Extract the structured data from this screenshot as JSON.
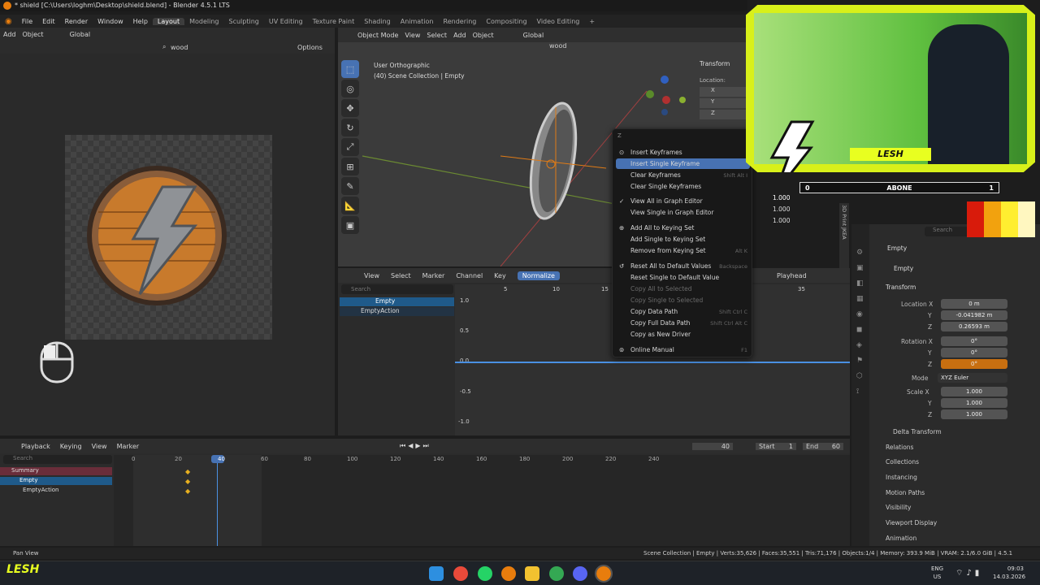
{
  "window": {
    "title": "* shield [C:\\Users\\loghm\\Desktop\\shield.blend] - Blender 4.5.1 LTS"
  },
  "menu": {
    "items": [
      "File",
      "Edit",
      "Render",
      "Window",
      "Help"
    ],
    "tabs": [
      "Layout",
      "Modeling",
      "Sculpting",
      "UV Editing",
      "Texture Paint",
      "Shading",
      "Animation",
      "Rendering",
      "Compositing",
      "Video Editing"
    ],
    "active_tab": "Layout"
  },
  "left_header": {
    "add": "Add",
    "object": "Object",
    "global": "Global",
    "search": "wood",
    "options": "Options"
  },
  "viewport": {
    "mode": "Object Mode",
    "view": "View",
    "select": "Select",
    "add": "Add",
    "object": "Object",
    "global": "Global",
    "search": "wood",
    "info1": "User Orthographic",
    "info2": "(40) Scene Collection | Empty",
    "transform_label": "Transform",
    "location_label": "Location:",
    "x": "X",
    "y": "Y",
    "z": "Z",
    "scale_vals": [
      "1.000",
      "1.000",
      "1.000"
    ]
  },
  "context_menu": {
    "title": "Z",
    "items": [
      {
        "label": "Insert Keyframes",
        "shortcut": "",
        "disabled": false,
        "icon": "⊙"
      },
      {
        "label": "Insert Single Keyframe",
        "shortcut": "",
        "disabled": false,
        "icon": "",
        "hl": true
      },
      {
        "label": "Clear Keyframes",
        "shortcut": "Shift Alt I",
        "disabled": false,
        "icon": ""
      },
      {
        "label": "Clear Single Keyframes",
        "shortcut": "",
        "disabled": false,
        "icon": ""
      },
      {
        "label": "View All in Graph Editor",
        "shortcut": "",
        "disabled": false,
        "icon": "✓"
      },
      {
        "label": "View Single in Graph Editor",
        "shortcut": "",
        "disabled": false,
        "icon": ""
      },
      {
        "label": "Add All to Keying Set",
        "shortcut": "",
        "disabled": false,
        "icon": "⊕"
      },
      {
        "label": "Add Single to Keying Set",
        "shortcut": "",
        "disabled": false,
        "icon": ""
      },
      {
        "label": "Remove from Keying Set",
        "shortcut": "Alt K",
        "disabled": false,
        "icon": ""
      },
      {
        "label": "Reset All to Default Values",
        "shortcut": "Backspace",
        "disabled": false,
        "icon": "↺"
      },
      {
        "label": "Reset Single to Default Value",
        "shortcut": "",
        "disabled": false,
        "icon": ""
      },
      {
        "label": "Copy All to Selected",
        "shortcut": "",
        "disabled": true,
        "icon": ""
      },
      {
        "label": "Copy Single to Selected",
        "shortcut": "",
        "disabled": true,
        "icon": ""
      },
      {
        "label": "Copy Data Path",
        "shortcut": "Shift Ctrl C",
        "disabled": false,
        "icon": ""
      },
      {
        "label": "Copy Full Data Path",
        "shortcut": "Shift Ctrl Alt C",
        "disabled": false,
        "icon": ""
      },
      {
        "label": "Copy as New Driver",
        "shortcut": "",
        "disabled": false,
        "icon": ""
      },
      {
        "label": "Online Manual",
        "shortcut": "F1",
        "disabled": false,
        "icon": "⊚"
      }
    ]
  },
  "graph": {
    "view": "View",
    "select": "Select",
    "marker": "Marker",
    "channel": "Channel",
    "key": "Key",
    "normalize": "Normalize",
    "playhead": "Playhead",
    "search": "Search",
    "ch_empty": "Empty",
    "ch_action": "EmptyAction",
    "ticks": [
      "5",
      "10",
      "15",
      "35"
    ],
    "yticks": [
      "1.0",
      "0.5",
      "0.0",
      "-0.5",
      "-1.0"
    ]
  },
  "timeline": {
    "playback": "Playback",
    "keying": "Keying",
    "view": "View",
    "marker": "Marker",
    "frame": "40",
    "start_label": "Start",
    "start": "1",
    "end_label": "End",
    "end": "60",
    "search": "Search",
    "ticks": [
      "0",
      "20",
      "40",
      "60",
      "80",
      "100",
      "120",
      "140",
      "160",
      "180",
      "200",
      "220",
      "240"
    ],
    "summary": "Summary",
    "empty": "Empty",
    "action": "EmptyAction"
  },
  "props": {
    "search": "Search",
    "object_name": "Empty",
    "data_name": "Empty",
    "transform": "Transform",
    "loc_x_label": "Location X",
    "loc_x": "0 m",
    "loc_y": "-0.041982 m",
    "loc_z": "0.26593 m",
    "rot_x_label": "Rotation X",
    "rot_x": "0°",
    "rot_y": "0°",
    "rot_z": "0°",
    "mode_label": "Mode",
    "mode": "XYZ Euler",
    "scale_x_label": "Scale X",
    "scale": [
      "1.000",
      "1.000",
      "1.000"
    ],
    "y": "Y",
    "z": "Z",
    "sections": [
      "Delta Transform",
      "Relations",
      "Collections",
      "Instancing",
      "Motion Paths",
      "Visibility",
      "Viewport Display",
      "Animation"
    ]
  },
  "side_tabs": [
    "3D Print",
    "JKEA"
  ],
  "overlay": {
    "streamer": "LESH",
    "sub_left": "0",
    "sub_label": "ABONE",
    "sub_right": "1"
  },
  "status": {
    "left": "Pan View",
    "right": "Scene Collection | Empty | Verts:35,626 | Faces:35,551 | Tris:71,176 | Objects:1/4 | Memory: 393.9 MiB | VRAM: 2.1/6.0 GiB | 4.5.1"
  },
  "taskbar": {
    "lang": "ENG",
    "lang2": "US",
    "time": "09:03",
    "date": "14.03.2026"
  },
  "watermark": "LESH",
  "colors": {
    "accent": "#4772b3",
    "orange": "#e07b16",
    "yellow": "#e8ff20"
  }
}
